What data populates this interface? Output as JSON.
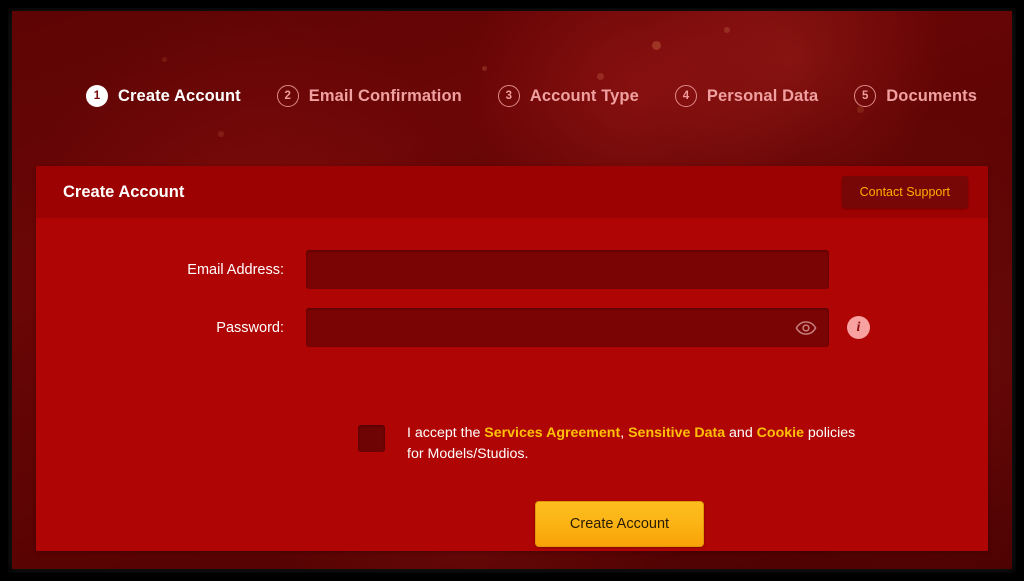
{
  "stepper": {
    "steps": [
      {
        "number": "1",
        "label": "Create Account",
        "state": "active"
      },
      {
        "number": "2",
        "label": "Email Confirmation",
        "state": "inactive"
      },
      {
        "number": "3",
        "label": "Account Type",
        "state": "inactive"
      },
      {
        "number": "4",
        "label": "Personal Data",
        "state": "inactive"
      },
      {
        "number": "5",
        "label": "Documents",
        "state": "inactive"
      }
    ]
  },
  "card": {
    "title": "Create Account",
    "support_button": "Contact Support"
  },
  "form": {
    "email": {
      "label": "Email Address:",
      "value": "",
      "placeholder": ""
    },
    "password": {
      "label": "Password:",
      "value": "",
      "placeholder": "",
      "toggle_icon": "eye-icon",
      "info_icon": "info-icon"
    },
    "terms": {
      "checked": false,
      "text_before": "I accept the ",
      "link_services": "Services Agreement",
      "separator_1": ", ",
      "link_sensitive": "Sensitive Data",
      "separator_2": " and ",
      "link_cookie": "Cookie",
      "text_after": " policies for Models/Studios."
    },
    "submit_button": "Create Account"
  },
  "colors": {
    "page_background": "#5e0404",
    "card_background": "#b00505",
    "card_header": "#9d0202",
    "input_background": "#7a0404",
    "accent_gold": "#ffc107",
    "submit_gold": "#fcb415",
    "support_text": "#ffae00",
    "active_step_text": "#ffffff",
    "inactive_step_text": "#f0a0a0",
    "info_icon_background": "#f7a1a1"
  }
}
